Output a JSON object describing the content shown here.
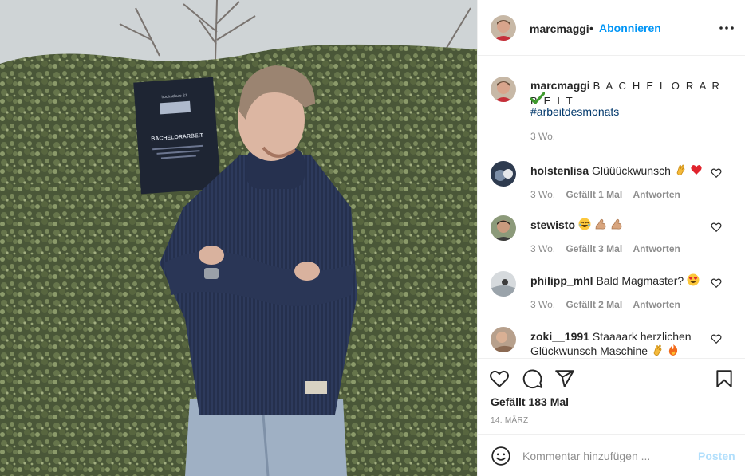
{
  "post": {
    "author": "marcmaggi",
    "separator": "•",
    "follow_label": "Abonnieren",
    "caption_text": "B A C H E L O R A R B E I T",
    "hashtag": "#arbeitdesmonats",
    "caption_time": "3 Wo.",
    "likes": "Gefällt 183 Mal",
    "date": "14. MÄRZ",
    "book": {
      "publisher": "hochschule 21",
      "title": "BACHELORARBEIT"
    }
  },
  "comments": [
    {
      "user": "holstenlisa",
      "text": "Glüüückwunsch",
      "emojis": [
        "clap-emoji",
        "red-heart-emoji"
      ],
      "time": "3 Wo.",
      "likes": "Gefällt 1 Mal",
      "reply": "Antworten"
    },
    {
      "user": "stewisto",
      "text": "",
      "emojis": [
        "laughing-emoji",
        "flexed-biceps-emoji",
        "flexed-biceps-emoji"
      ],
      "time": "3 Wo.",
      "likes": "Gefällt 3 Mal",
      "reply": "Antworten"
    },
    {
      "user": "philipp_mhl",
      "text": "Bald Magmaster?",
      "emojis": [
        "heart-eyes-emoji"
      ],
      "time": "3 Wo.",
      "likes": "Gefällt 2 Mal",
      "reply": "Antworten"
    },
    {
      "user": "zoki__1991",
      "text": "Staaaark herzlichen Glückwunsch Maschine",
      "emojis": [
        "clap-emoji",
        "fire-emoji"
      ]
    }
  ],
  "add_comment": {
    "placeholder": "Kommentar hinzufügen ...",
    "post_label": "Posten"
  },
  "colors": {
    "accent": "#0095f6",
    "hashtag": "#00376b",
    "muted": "#8e8e8e",
    "post_disabled": "#b2dffc"
  },
  "icons": [
    "more-options-icon",
    "like-heart-icon",
    "comment-icon",
    "share-icon",
    "save-bookmark-icon",
    "emoji-smiley-icon",
    "small-like-heart-icon",
    "green-check-emoji"
  ]
}
